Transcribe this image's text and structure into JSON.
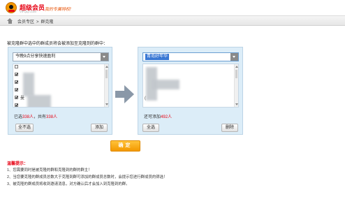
{
  "header": {
    "logo_title": "超级会员",
    "logo_subtitle": "VIP.QQ.COM",
    "slogan": "我的专属特权!"
  },
  "breadcrumb": {
    "items": [
      "会员专区",
      "群克隆"
    ],
    "separator": ">"
  },
  "instruction": "被克隆群中选中的群成员将会被添加至克隆到的群中：",
  "source_panel": {
    "group_select": "今晚9点分享快速盈利",
    "members": [
      {
        "checked": false,
        "label": ""
      },
      {
        "checked": true,
        "label": ""
      },
      {
        "checked": true,
        "label": ""
      },
      {
        "checked": true,
        "label": ""
      },
      {
        "checked": true,
        "label": "曼"
      },
      {
        "checked": true,
        "label": ""
      }
    ],
    "count_prefix": "已选",
    "selected_count": "338人",
    "count_sep": "，共有",
    "total_count": "338人",
    "unselect_all_label": "全不选",
    "add_label": "添加"
  },
  "target_panel": {
    "group_select": "青岛好年华",
    "members": [
      "",
      "",
      "",
      "",
      "(",
      ""
    ],
    "count_prefix": "还可添加",
    "remaining_count": "492人",
    "select_all_label": "全选",
    "delete_label": "删除"
  },
  "confirm_label": "确定",
  "tips": {
    "title": "温馨提示：",
    "items": [
      "1、您需要同时是被克隆的群和克隆到的群的群主！",
      "2、当您要克隆的群成员总数大于克隆到群可添加的群成员总数时，会提示您进行群成员的筛选！",
      "3、被克隆的群成员将收到邀请消息，对方确认后才会加入到克隆到的群。"
    ]
  },
  "colors": {
    "brand_red": "#e60012",
    "confirm_orange": "#f39800",
    "panel_bg": "#dcedf8",
    "selection_blue": "#3a78d4"
  }
}
